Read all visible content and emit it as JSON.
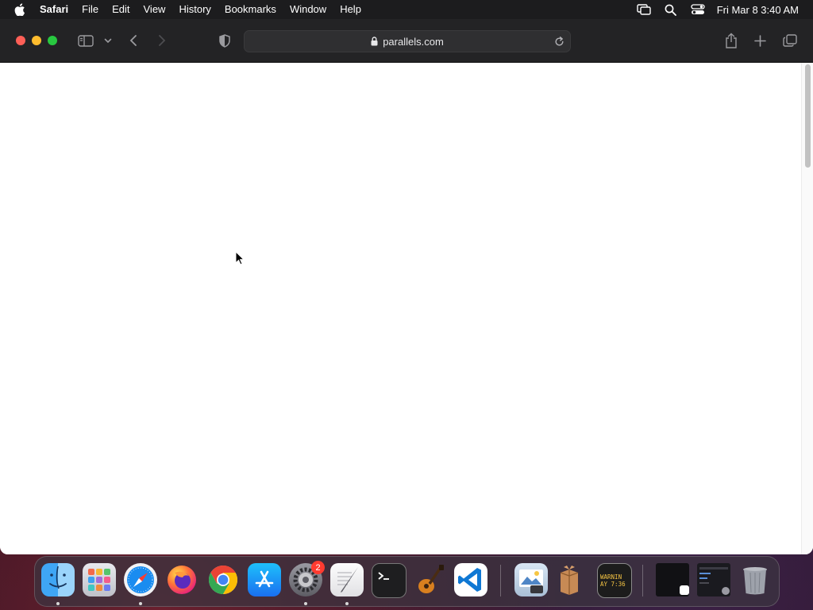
{
  "menubar": {
    "app_name": "Safari",
    "items": [
      "File",
      "Edit",
      "View",
      "History",
      "Bookmarks",
      "Window",
      "Help"
    ],
    "clock": "Fri Mar 8  3:40 AM",
    "status_icons": [
      "screen-mirroring-icon",
      "spotlight-search-icon",
      "control-center-icon"
    ]
  },
  "browser": {
    "url": "parallels.com",
    "secure": true,
    "toolbar_icons": [
      "sidebar-icon",
      "chevron-down-icon",
      "back-icon",
      "forward-icon",
      "privacy-shield-icon",
      "share-icon",
      "new-tab-icon",
      "tab-overview-icon"
    ]
  },
  "dock": {
    "apps": [
      "Finder",
      "Launchpad",
      "Safari",
      "Firefox",
      "Google Chrome",
      "App Store",
      "System Settings",
      "TextEdit",
      "Terminal",
      "GarageBand",
      "Visual Studio Code",
      "Preview",
      "Archive Utility",
      "Console"
    ],
    "system_settings_badge": "2",
    "console_text": "WARNIN\nAY 7:36",
    "colors": {
      "close": "#fe5f57",
      "minimize": "#febc2e",
      "maximize": "#28c840"
    }
  }
}
